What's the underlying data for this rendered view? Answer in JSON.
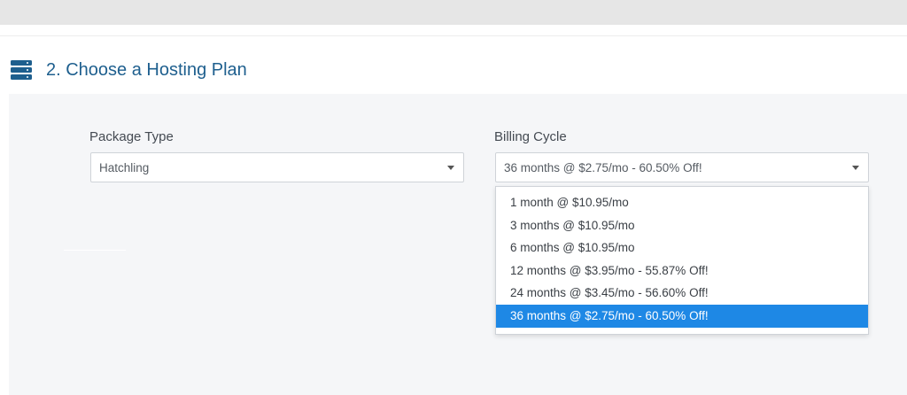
{
  "section": {
    "title": "2. Choose a Hosting Plan",
    "icon": "server-stack-icon"
  },
  "package_type": {
    "label": "Package Type",
    "value": "Hatchling"
  },
  "billing_cycle": {
    "label": "Billing Cycle",
    "value": "36 months @ $2.75/mo - 60.50% Off!",
    "options": [
      "1 month @ $10.95/mo",
      "3 months @ $10.95/mo",
      "6 months @ $10.95/mo",
      "12 months @ $3.95/mo - 55.87% Off!",
      "24 months @ $3.45/mo - 56.60% Off!",
      "36 months @ $2.75/mo - 60.50% Off!"
    ],
    "selected_index": 5
  },
  "colors": {
    "title": "#1e5f8e",
    "highlight": "#1e88e5",
    "panel": "#f5f6f8"
  }
}
